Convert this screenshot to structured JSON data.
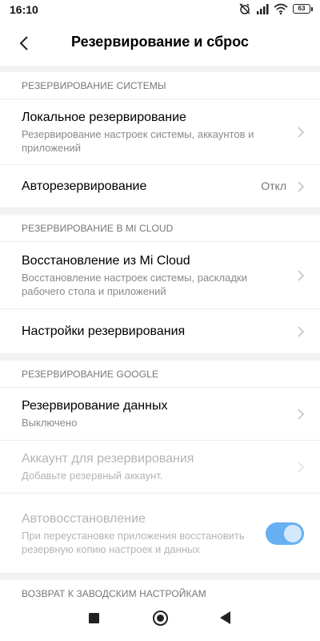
{
  "status_bar": {
    "time": "16:10",
    "battery": "63"
  },
  "header": {
    "title": "Резервирование и сброс"
  },
  "sections": {
    "system": {
      "header": "РЕЗЕРВИРОВАНИЕ СИСТЕМЫ",
      "local_title": "Локальное резервирование",
      "local_sub": "Резервирование настроек системы, аккаунтов и приложений",
      "auto_title": "Авторезервирование",
      "auto_value": "Откл"
    },
    "mi_cloud": {
      "header": "РЕЗЕРВИРОВАНИЕ В MI CLOUD",
      "restore_title": "Восстановление из Mi Cloud",
      "restore_sub": "Восстановление настроек системы, раскладки рабочего стола и приложений",
      "settings_title": "Настройки резервирования"
    },
    "google": {
      "header": "РЕЗЕРВИРОВАНИЕ GOOGLE",
      "backup_title": "Резервирование данных",
      "backup_sub": "Выключено",
      "account_title": "Аккаунт для резервирования",
      "account_sub": "Добавьте резервный аккаунт.",
      "autorestore_title": "Автовосстановление",
      "autorestore_sub": "При переустановке приложения восстановить резервную копию настроек и данных",
      "autorestore_on": true
    },
    "factory": {
      "header": "ВОЗВРАТ К ЗАВОДСКИМ НАСТРОЙКАМ"
    }
  },
  "icons": {
    "back": "chevron-left-icon",
    "chevron": "chevron-right-icon",
    "nav_recents": "square-icon",
    "nav_home": "circle-icon",
    "nav_back": "triangle-back-icon"
  },
  "colors": {
    "toggle": "#4ca3f2",
    "divider": "#ececec",
    "section_bg": "#f2f2f2"
  }
}
